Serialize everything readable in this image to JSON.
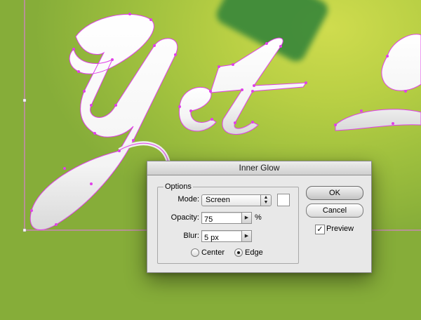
{
  "dialog": {
    "title": "Inner Glow",
    "options_group": "Options",
    "mode": {
      "label": "Mode:",
      "value": "Screen"
    },
    "opacity": {
      "label": "Opacity:",
      "value": "75",
      "unit": "%"
    },
    "blur": {
      "label": "Blur:",
      "value": "5 px"
    },
    "source": {
      "center_label": "Center",
      "edge_label": "Edge",
      "selected": "Edge"
    },
    "buttons": {
      "ok": "OK",
      "cancel": "Cancel"
    },
    "preview": {
      "label": "Preview",
      "checked": true
    },
    "glow_color": "#ffffff"
  },
  "artwork": {
    "text": "Yet ",
    "fill": "#ffffff",
    "path_color": "#e040e8",
    "background": "#a8c43f"
  }
}
